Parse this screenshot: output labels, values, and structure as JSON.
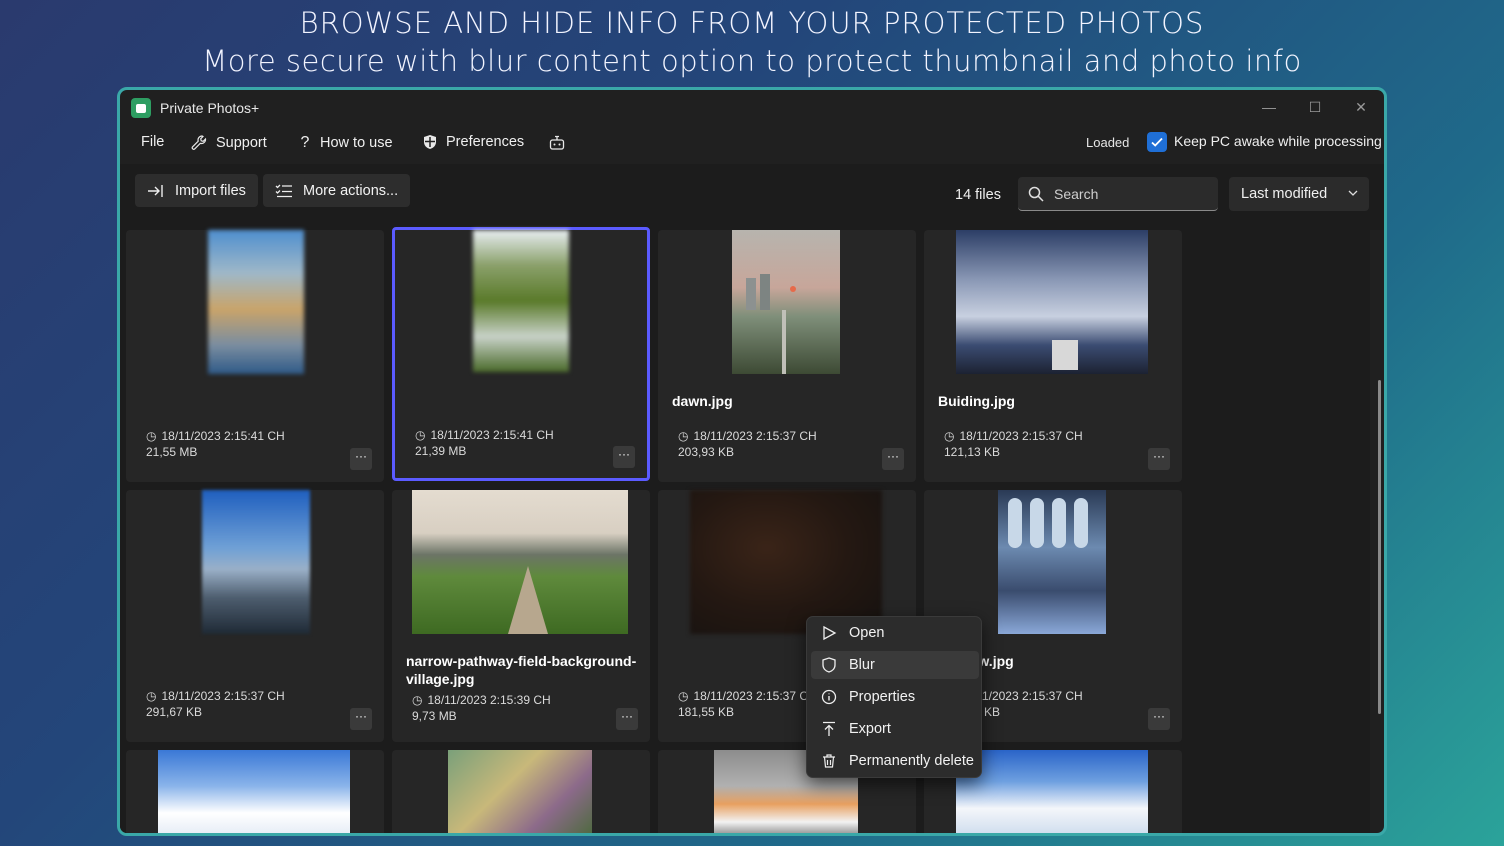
{
  "promo": {
    "line1": "BROWSE AND HIDE INFO FROM YOUR PROTECTED PHOTOS",
    "line2": "More secure with blur content option to protect thumbnail and photo info"
  },
  "window": {
    "title": "Private Photos+",
    "controls": {
      "minimize": "—",
      "maximize": "☐",
      "close": "✕"
    }
  },
  "menu": {
    "file": "File",
    "support": "Support",
    "how_to_use": "How to use",
    "preferences": "Preferences",
    "loaded": "Loaded",
    "keep_awake": "Keep PC awake while processing",
    "keep_awake_checked": true
  },
  "toolbar": {
    "import": "Import files",
    "more_actions": "More actions...",
    "files_count": "14 files",
    "search_placeholder": "Search",
    "sort_value": "Last modified"
  },
  "more_label": "···",
  "cards": [
    {
      "name": "",
      "date": "18/11/2023 2:15:41 CH",
      "size": "21,55 MB",
      "blurred": true
    },
    {
      "name": "",
      "date": "18/11/2023 2:15:41 CH",
      "size": "21,39 MB",
      "blurred": true,
      "selected": true
    },
    {
      "name": "dawn.jpg",
      "date": "18/11/2023 2:15:37 CH",
      "size": "203,93 KB"
    },
    {
      "name": "Buiding.jpg",
      "date": "18/11/2023 2:15:37 CH",
      "size": "121,13 KB"
    },
    {
      "name": "",
      "date": "18/11/2023 2:15:37 CH",
      "size": "291,67 KB",
      "blurred": true
    },
    {
      "name": "narrow-pathway-field-background-village.jpg",
      "date": "18/11/2023 2:15:39 CH",
      "size": "9,73 MB"
    },
    {
      "name": "",
      "date": "18/11/2023 2:15:37 CH",
      "size": "181,55 KB",
      "blurred": true
    },
    {
      "name": "window.jpg",
      "date": "18/11/2023 2:15:37 CH",
      "size": "258,47 KB"
    }
  ],
  "context_menu": {
    "open": "Open",
    "blur": "Blur",
    "properties": "Properties",
    "export": "Export",
    "delete": "Permanently delete"
  },
  "colors": {
    "accent": "#1f6fd6",
    "selection": "#5b5bff",
    "window_border": "#3aa8a8"
  }
}
